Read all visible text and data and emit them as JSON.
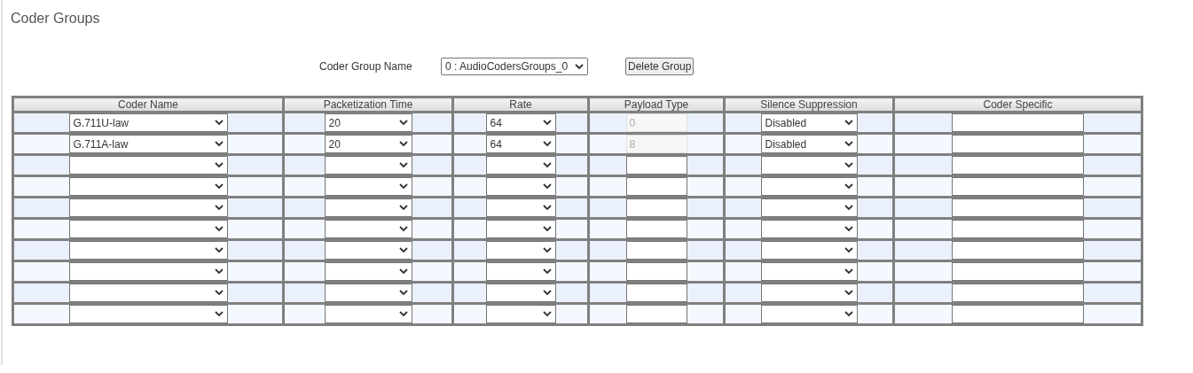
{
  "page_title": "Coder Groups",
  "group": {
    "label": "Coder Group Name",
    "value": "0 : AudioCodersGroups_0",
    "button": "Delete Group"
  },
  "table": {
    "columns": [
      "Coder Name",
      "Packetization Time",
      "Rate",
      "Payload Type",
      "Silence Suppression",
      "Coder Specific"
    ],
    "rows": [
      {
        "coder_name": "G.711U-law",
        "ptime": "20",
        "rate": "64",
        "payload_type": {
          "value": "0",
          "disabled": true
        },
        "silence": "Disabled"
      },
      {
        "coder_name": "G.711A-law",
        "ptime": "20",
        "rate": "64",
        "payload_type": {
          "value": "8",
          "disabled": true
        },
        "silence": "Disabled"
      },
      {
        "payload_type": {
          "disabled": false
        }
      },
      {
        "payload_type": {
          "disabled": false
        }
      },
      {
        "payload_type": {
          "disabled": false
        }
      },
      {
        "payload_type": {
          "disabled": false
        }
      },
      {
        "payload_type": {
          "disabled": false
        }
      },
      {
        "payload_type": {
          "disabled": false
        }
      },
      {
        "payload_type": {
          "disabled": false
        }
      },
      {
        "payload_type": {
          "disabled": false
        }
      }
    ]
  }
}
